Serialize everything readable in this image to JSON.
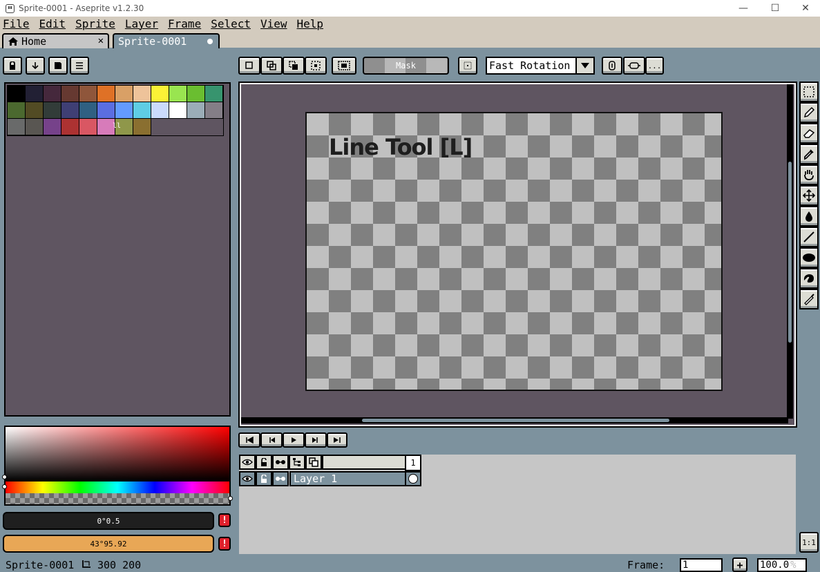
{
  "window": {
    "title": "Sprite-0001 - Aseprite v1.2.30",
    "minimize": "—",
    "maximize": "☐",
    "close": "✕"
  },
  "menu": [
    "File",
    "Edit",
    "Sprite",
    "Layer",
    "Frame",
    "Select",
    "View",
    "Help"
  ],
  "tabs": {
    "home_label": "Home",
    "home_close": "✕",
    "sprite_label": "Sprite-0001"
  },
  "palette": {
    "colors": [
      "#000000",
      "#222034",
      "#45283c",
      "#663931",
      "#8f563b",
      "#df7126",
      "#d9a066",
      "#eec39a",
      "#fbf236",
      "#99e550",
      "#6abe30",
      "#37946e",
      "#4b692f",
      "#524b24",
      "#323c39",
      "#3f3f74",
      "#306082",
      "#5b6ee1",
      "#639bff",
      "#5fcde4",
      "#cbdbfc",
      "#ffffff",
      "#9badb7",
      "#847e87",
      "#696a6a",
      "#595652",
      "#76428a",
      "#ac3232",
      "#d95763",
      "#d77bba",
      "#8f974a",
      "#8a6f30"
    ],
    "grip": "ll"
  },
  "context_bar": {
    "mask_label": "Mask",
    "rotation_algorithm": "Fast Rotation",
    "more_label": "..."
  },
  "editor": {
    "tool_tip": "Line Tool [L]"
  },
  "colors": {
    "foreground_label": "0°0.5",
    "background_label": "43°95.92",
    "foreground_hex": "#1f1f1f",
    "background_hex": "#e8a756",
    "warning": "!"
  },
  "timeline": {
    "frame_number": "1",
    "layer_name": "Layer 1"
  },
  "status": {
    "sprite_name": "Sprite-0001",
    "sprite_size": "300 200",
    "frame_label": "Frame:",
    "frame_value": "1",
    "add_frame": "+",
    "zoom_value": "100.0",
    "zoom_unit": "%",
    "one_to_one": "1:1"
  }
}
